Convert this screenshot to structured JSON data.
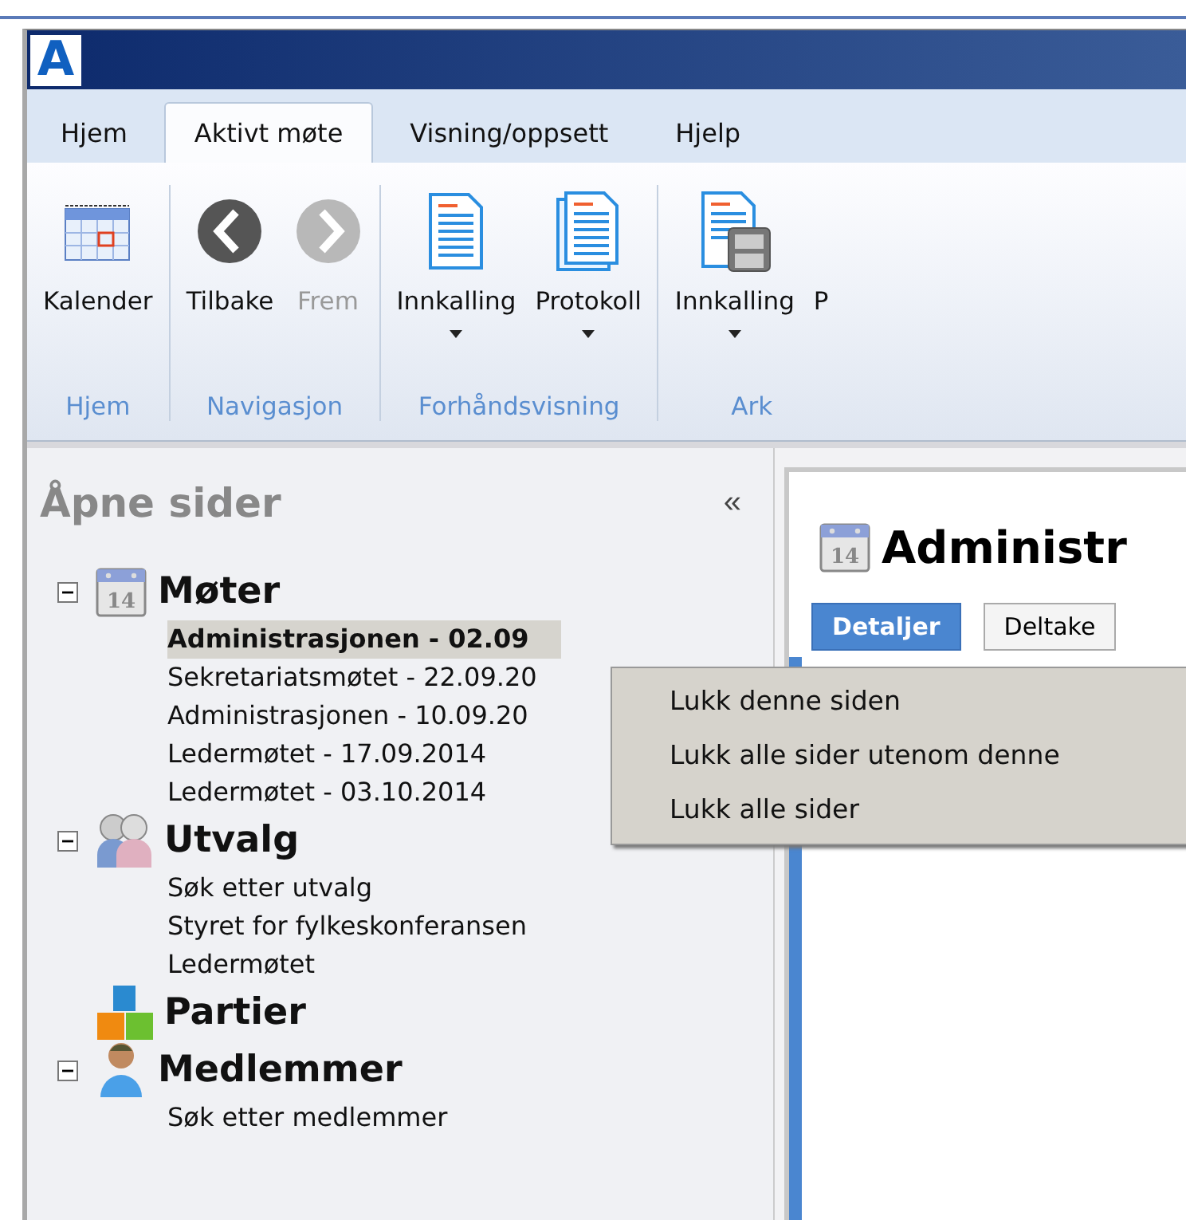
{
  "window": {
    "logo": "A"
  },
  "tabs": [
    {
      "label": "Hjem",
      "selected": false
    },
    {
      "label": "Aktivt møte",
      "selected": true
    },
    {
      "label": "Visning/oppsett",
      "selected": false
    },
    {
      "label": "Hjelp",
      "selected": false
    }
  ],
  "ribbon": {
    "groups": [
      {
        "label": "Hjem",
        "buttons": [
          {
            "label": "Kalender",
            "kind": "calendar",
            "disabled": false,
            "dropdown": false
          }
        ]
      },
      {
        "label": "Navigasjon",
        "buttons": [
          {
            "label": "Tilbake",
            "kind": "back",
            "disabled": false,
            "dropdown": false
          },
          {
            "label": "Frem",
            "kind": "forward",
            "disabled": true,
            "dropdown": false
          }
        ]
      },
      {
        "label": "Forhåndsvisning",
        "buttons": [
          {
            "label": "Innkalling",
            "kind": "document",
            "disabled": false,
            "dropdown": true
          },
          {
            "label": "Protokoll",
            "kind": "documents",
            "disabled": false,
            "dropdown": true
          }
        ]
      },
      {
        "label": "Ark",
        "buttons": [
          {
            "label": "Innkalling",
            "kind": "archive",
            "disabled": false,
            "dropdown": true
          },
          {
            "label": "P",
            "kind": "partial",
            "disabled": false,
            "dropdown": false
          }
        ]
      }
    ]
  },
  "sidebar": {
    "title": "Åpne sider",
    "collapse": "«",
    "tree": [
      {
        "label": "Møter",
        "kind": "calendar",
        "calendar_day": "14",
        "expanded": true,
        "children": [
          {
            "label": "Administrasjonen - 02.09",
            "selected": true
          },
          {
            "label": "Sekretariatsmøtet - 22.09.20",
            "selected": false
          },
          {
            "label": "Administrasjonen - 10.09.20",
            "selected": false
          },
          {
            "label": "Ledermøtet - 17.09.2014",
            "selected": false
          },
          {
            "label": "Ledermøtet - 03.10.2014",
            "selected": false
          }
        ]
      },
      {
        "label": "Utvalg",
        "kind": "people",
        "expanded": true,
        "children": [
          {
            "label": "Søk etter utvalg",
            "selected": false
          },
          {
            "label": "Styret for fylkeskonferansen",
            "selected": false
          },
          {
            "label": "Ledermøtet",
            "selected": false
          }
        ]
      },
      {
        "label": "Partier",
        "kind": "blocks"
      },
      {
        "label": "Medlemmer",
        "kind": "person",
        "expanded": true,
        "children": [
          {
            "label": "Søk etter medlemmer",
            "selected": false
          }
        ]
      }
    ]
  },
  "content": {
    "calendar_day": "14",
    "title": "Administr",
    "tabs": [
      {
        "label": "Detaljer",
        "selected": true
      },
      {
        "label": "Deltake",
        "selected": false
      }
    ]
  },
  "context_menu": {
    "items": [
      "Lukk denne siden",
      "Lukk alle sider utenom denne",
      "Lukk alle sider"
    ]
  }
}
